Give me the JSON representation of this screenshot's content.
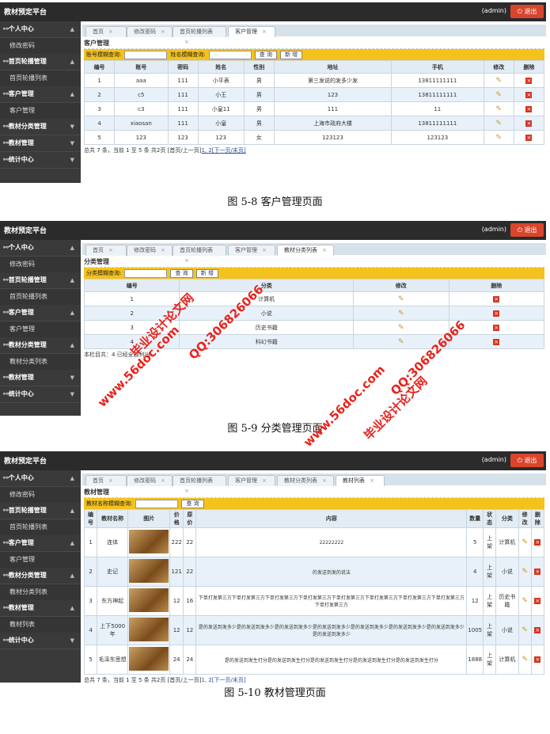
{
  "app_title": "教材预定平台",
  "admin": "(admin)",
  "logout": "退出",
  "screens": [
    {
      "sidebar": [
        {
          "t": "head",
          "label": "个人中心"
        },
        {
          "t": "sub",
          "label": "修改密码"
        },
        {
          "t": "head",
          "label": "首页轮播管理"
        },
        {
          "t": "sub",
          "label": "首页轮播列表"
        },
        {
          "t": "head",
          "label": "客户管理"
        },
        {
          "t": "sub",
          "label": "客户管理"
        },
        {
          "t": "head",
          "label": "教材分类管理"
        },
        {
          "t": "head",
          "label": "教材管理"
        },
        {
          "t": "head",
          "label": "统计中心"
        }
      ],
      "tabs": [
        "首页",
        "修改密码",
        "首页轮播列表",
        "客户管理"
      ],
      "active_tab": 3,
      "page_title": "客户管理",
      "query": {
        "label1": "账号模糊查询:",
        "label2": "姓名模糊查询:",
        "search": "查 询",
        "add": "新 增"
      },
      "headers": [
        "编号",
        "账号",
        "密码",
        "姓名",
        "性别",
        "地址",
        "手机",
        "修改",
        "删除"
      ],
      "rows": [
        [
          "1",
          "aaa",
          "111",
          "小平表",
          "男",
          "第三发说的发多少发",
          "13811111111"
        ],
        [
          "2",
          "c5",
          "111",
          "小王",
          "男",
          "123",
          "13811111111"
        ],
        [
          "3",
          "c3",
          "111",
          "小皇11",
          "男",
          "111",
          "11"
        ],
        [
          "4",
          "xiaosan",
          "111",
          "小皇",
          "男",
          "上海市政府大楼",
          "13811111111"
        ],
        [
          "5",
          "123",
          "123",
          "123",
          "女",
          "123123",
          "123123"
        ]
      ],
      "pager": {
        "text": "总共 7 条，当前 1 至 5 条 共2页 [首页/上一页]",
        "pages": "1, 2",
        "next": "[下一页/末页]"
      },
      "caption": "图 5-8 客户管理页面"
    },
    {
      "sidebar": [
        {
          "t": "head",
          "label": "个人中心"
        },
        {
          "t": "sub",
          "label": "修改密码"
        },
        {
          "t": "head",
          "label": "首页轮播管理"
        },
        {
          "t": "sub",
          "label": "首页轮播列表"
        },
        {
          "t": "head",
          "label": "客户管理"
        },
        {
          "t": "sub",
          "label": "客户管理"
        },
        {
          "t": "head",
          "label": "教材分类管理"
        },
        {
          "t": "sub",
          "label": "教材分类列表"
        },
        {
          "t": "head",
          "label": "教材管理"
        },
        {
          "t": "head",
          "label": "统计中心"
        }
      ],
      "tabs": [
        "首页",
        "修改密码",
        "首页轮播列表",
        "客户管理",
        "教材分类列表"
      ],
      "active_tab": 4,
      "page_title": "分类管理",
      "query": {
        "label1": "分类模糊查询:",
        "search": "查 询",
        "add": "新 增"
      },
      "headers": [
        "编号",
        "分类",
        "修改",
        "删除"
      ],
      "rows": [
        [
          "1",
          "计算机"
        ],
        [
          "2",
          "小说"
        ],
        [
          "3",
          "历史书籍"
        ],
        [
          "4",
          "科幻书籍"
        ]
      ],
      "pager": {
        "text": "本栏目共：4 已经全部列出"
      },
      "caption": "图 5-9 分类管理页面"
    },
    {
      "sidebar": [
        {
          "t": "head",
          "label": "个人中心"
        },
        {
          "t": "sub",
          "label": "修改密码"
        },
        {
          "t": "head",
          "label": "首页轮播管理"
        },
        {
          "t": "sub",
          "label": "首页轮播列表"
        },
        {
          "t": "head",
          "label": "客户管理"
        },
        {
          "t": "sub",
          "label": "客户管理"
        },
        {
          "t": "head",
          "label": "教材分类管理"
        },
        {
          "t": "sub",
          "label": "教材分类列表"
        },
        {
          "t": "head",
          "label": "教材管理"
        },
        {
          "t": "sub",
          "label": "教材列表"
        },
        {
          "t": "head",
          "label": "统计中心"
        }
      ],
      "tabs": [
        "首页",
        "修改密码",
        "首页轮播列表",
        "客户管理",
        "教材分类列表",
        "教材列表"
      ],
      "active_tab": 5,
      "page_title": "教材管理",
      "query": {
        "label1": "教材名称模糊查询:",
        "search": "查 询"
      },
      "headers": [
        "编号",
        "教材名称",
        "图片",
        "价格",
        "原价",
        "内容",
        "数量",
        "状态",
        "分类",
        "修改",
        "删除"
      ],
      "rows": [
        [
          "1",
          "连体",
          "",
          "222",
          "22",
          "22222222",
          "5",
          "上架",
          "计算机"
        ],
        [
          "2",
          "史记",
          "",
          "121",
          "22",
          "的发送到发的说法",
          "4",
          "上架",
          "小说"
        ],
        [
          "3",
          "东方神起",
          "",
          "12",
          "16",
          "下单打发第三方下单打发第三方下单打发第三方下单打发第三方下单打发第三方下单打发第三方下单打发第三方下单打发第三方下单打发第三方",
          "12",
          "上架",
          "历史书籍"
        ],
        [
          "4",
          "上下5000年",
          "",
          "12",
          "12",
          "是的发送到发多少是的发送到发多少是的发送到发多少是的发送到发多少是的发送到发多少是的发送到发多少是的发送到发多少是的发送到发多少",
          "1005",
          "上架",
          "小说"
        ],
        [
          "5",
          "毛泽东思想",
          "",
          "24",
          "24",
          "是的发送到发生打分是的发送到发生打分是的发送到发生打分是的发送到发生打分是的发送到发生打分",
          "1888",
          "上架",
          "计算机"
        ]
      ],
      "pager": {
        "text": "总共 7 条，当前 1 至 5 条 共2页 [首页/上一页]",
        "pages": "1, 2",
        "next": "[下一页/末页]"
      },
      "caption": "图 5-10 教材管理页面"
    }
  ],
  "watermarks": [
    "www.56doc.com",
    "QQ:306826066",
    "毕业设计论文网"
  ]
}
